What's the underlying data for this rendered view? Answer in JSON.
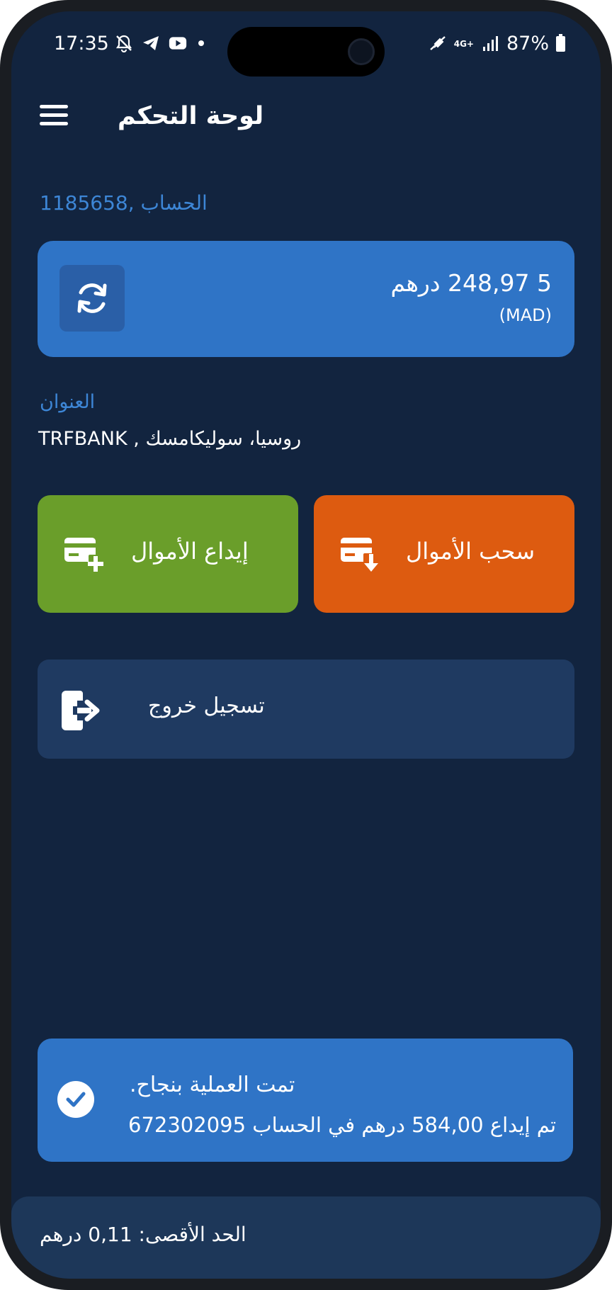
{
  "status_bar": {
    "time": "17:35",
    "network": "4G+",
    "battery": "87%",
    "icons": [
      "notifications-muted-icon",
      "telegram-icon",
      "youtube-icon",
      "dot-icon",
      "mute-mic-icon",
      "signal-icon",
      "battery-icon"
    ]
  },
  "appbar": {
    "title": "لوحة التحكم",
    "menu_icon": "hamburger-menu-icon"
  },
  "account": {
    "label": "الحساب ,1185658"
  },
  "balance": {
    "amount": "5 248,97 درهم",
    "currency": "(MAD)",
    "refresh_icon": "refresh-icon"
  },
  "address": {
    "label": "العنوان",
    "value": "TRFBANK , روسيا، سوليكامسك"
  },
  "actions": {
    "deposit_label": "إيداع الأموال",
    "withdraw_label": "سحب الأموال",
    "deposit_color": "#6a9e2a",
    "withdraw_color": "#dd5b10"
  },
  "logout": {
    "label": "تسجيل خروج"
  },
  "toast": {
    "title": "تمت العملية بنجاح.",
    "message": "تم إيداع 584,00 درهم في الحساب 672302095"
  },
  "footer": {
    "max_limit": "الحد الأقصى: 0,11 درهم"
  },
  "colors": {
    "background": "#12243f",
    "accent": "#2f74c6",
    "label_blue": "#3d86d6"
  }
}
